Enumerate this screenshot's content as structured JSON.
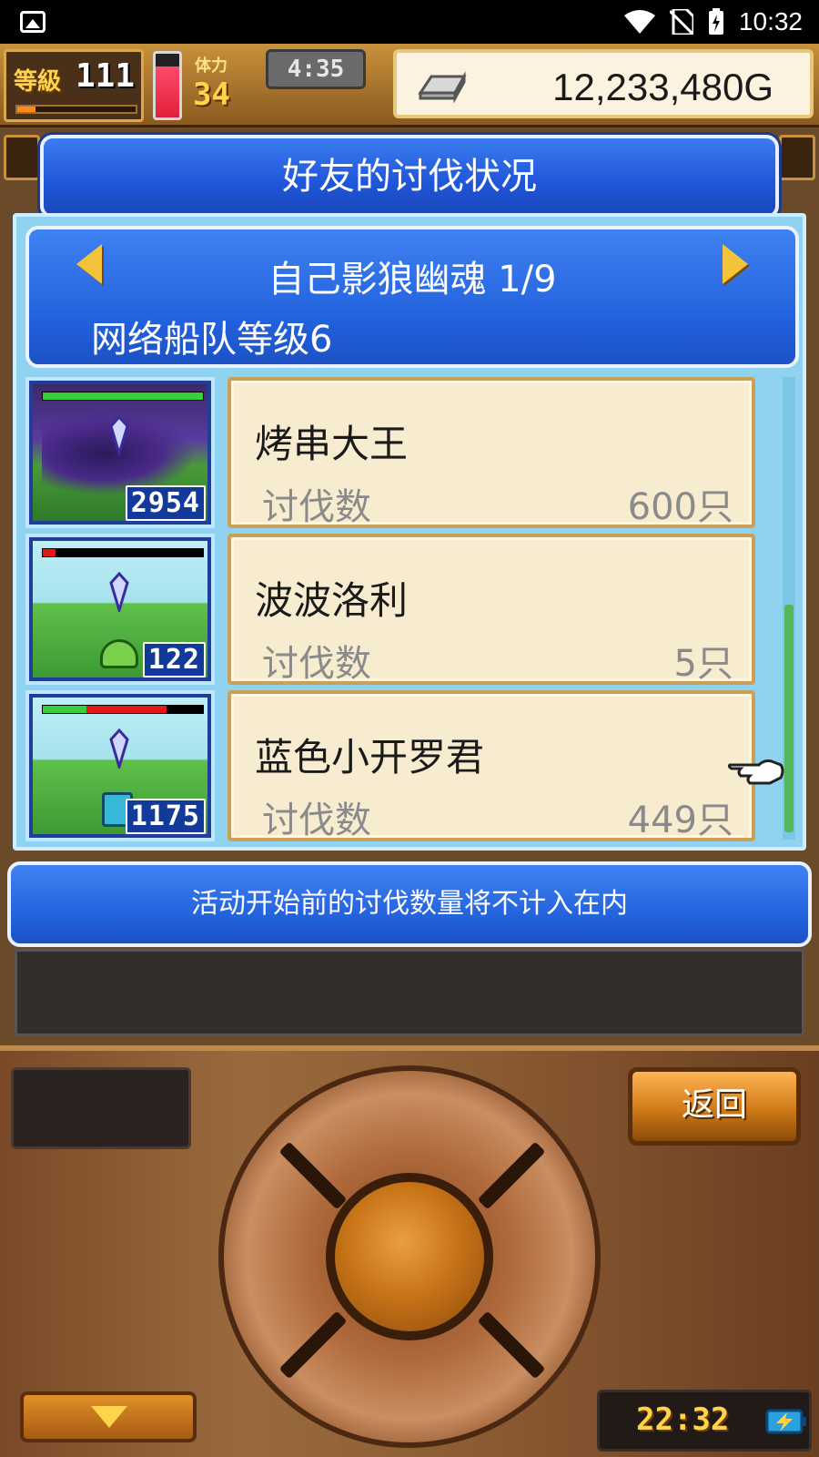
{
  "status_bar": {
    "time": "10:32",
    "icons": [
      "image-icon",
      "wifi-icon",
      "no-sim-icon",
      "battery-charging-icon"
    ]
  },
  "hud": {
    "level_tag": "等級",
    "level": "111",
    "level_progress": 0.15,
    "stamina_tag": "体力",
    "stamina": "34",
    "stamina_fill": 0.8,
    "timer": "4:35",
    "gold": "12,233,480G"
  },
  "title": "好友的讨伐状况",
  "player": {
    "name": "自己影狼幽魂 1/9",
    "fleet_level": "网络船队等级6"
  },
  "kill_label": "讨伐数",
  "monsters": [
    {
      "name": "烤串大王",
      "kills": "600只",
      "thumb_count": "2954",
      "hp": 1.0,
      "hp_lost": 0.0,
      "scene": "dark"
    },
    {
      "name": "波波洛利",
      "kills": "5只",
      "thumb_count": "122",
      "hp": 0.0,
      "hp_lost": 0.08,
      "scene": "light"
    },
    {
      "name": "蓝色小开罗君",
      "kills": "449只",
      "thumb_count": "1175",
      "hp": 0.27,
      "hp_lost": 0.5,
      "scene": "light"
    }
  ],
  "notice": "活动开始前的讨伐数量将不计入在内",
  "controller": {
    "back_label": "返回",
    "clock": "22:32"
  },
  "colors": {
    "panel_blue": "#2160dc",
    "card_bg": "#f8ecd0",
    "hp_green": "#36d03a",
    "hp_red": "#e01a1a",
    "gold_text": "#ffd34a"
  }
}
